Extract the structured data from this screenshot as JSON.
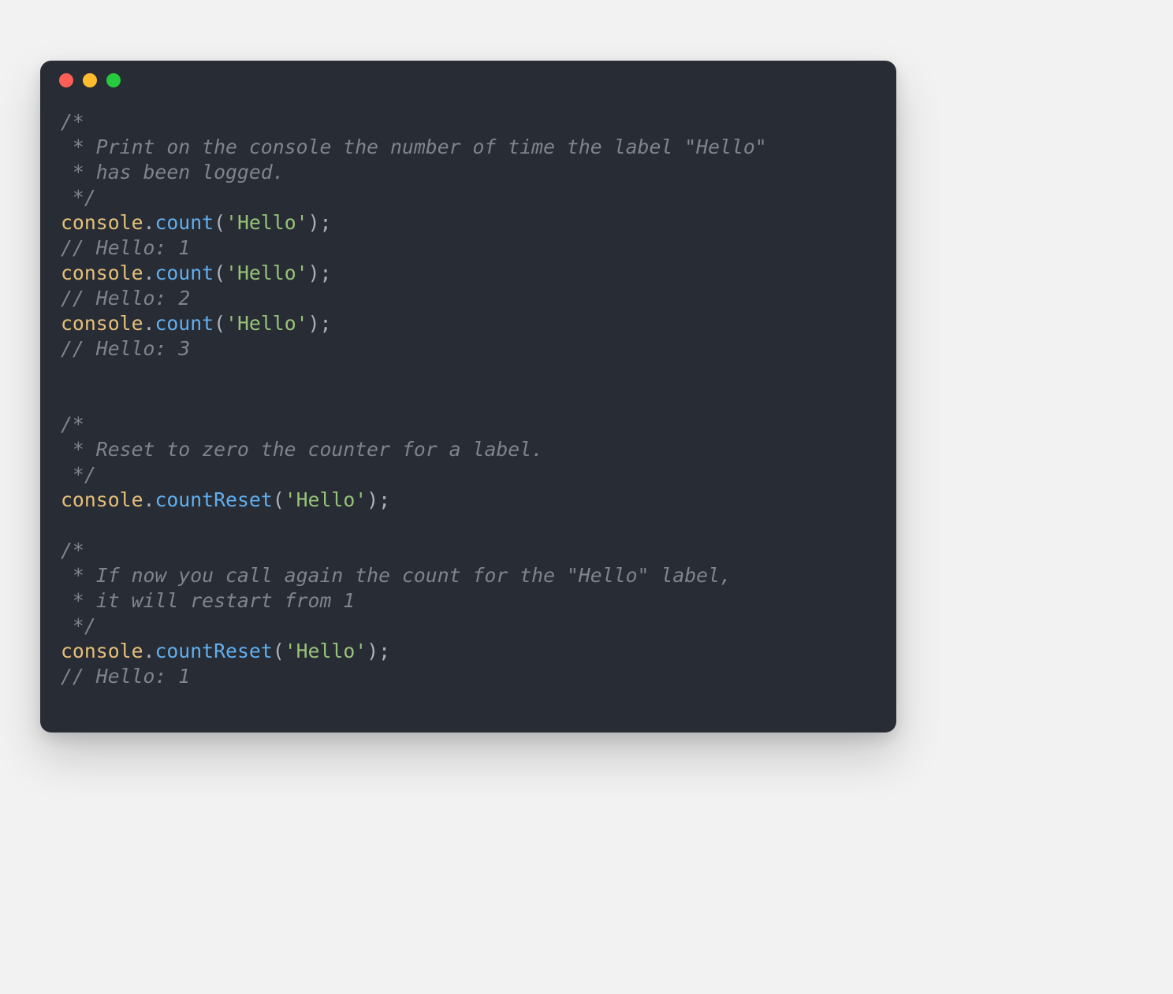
{
  "window": {
    "traffic_lights": {
      "red": "#ff5f56",
      "yellow": "#ffbd2e",
      "green": "#27c93f"
    },
    "background": "#282c34"
  },
  "code": {
    "colors": {
      "comment": "#7f848e",
      "object": "#e5c07b",
      "punct": "#abb2bf",
      "method": "#61afef",
      "string": "#98c379"
    },
    "block1": {
      "comment_l1": "/*",
      "comment_l2": " * Print on the console the number of time the label \"Hello\"",
      "comment_l3": " * has been logged.",
      "comment_l4": " */",
      "call1_obj": "console",
      "call1_dot": ".",
      "call1_fn": "count",
      "call1_open": "(",
      "call1_str": "'Hello'",
      "call1_close": ");",
      "out1": "// Hello: 1",
      "call2_obj": "console",
      "call2_dot": ".",
      "call2_fn": "count",
      "call2_open": "(",
      "call2_str": "'Hello'",
      "call2_close": ");",
      "out2": "// Hello: 2",
      "call3_obj": "console",
      "call3_dot": ".",
      "call3_fn": "count",
      "call3_open": "(",
      "call3_str": "'Hello'",
      "call3_close": ");",
      "out3": "// Hello: 3"
    },
    "block2": {
      "comment_l1": "/*",
      "comment_l2": " * Reset to zero the counter for a label.",
      "comment_l3": " */",
      "call_obj": "console",
      "call_dot": ".",
      "call_fn": "countReset",
      "call_open": "(",
      "call_str": "'Hello'",
      "call_close": ");"
    },
    "block3": {
      "comment_l1": "/*",
      "comment_l2": " * If now you call again the count for the \"Hello\" label,",
      "comment_l3": " * it will restart from 1",
      "comment_l4": " */",
      "call_obj": "console",
      "call_dot": ".",
      "call_fn": "countReset",
      "call_open": "(",
      "call_str": "'Hello'",
      "call_close": ");",
      "out": "// Hello: 1"
    }
  }
}
